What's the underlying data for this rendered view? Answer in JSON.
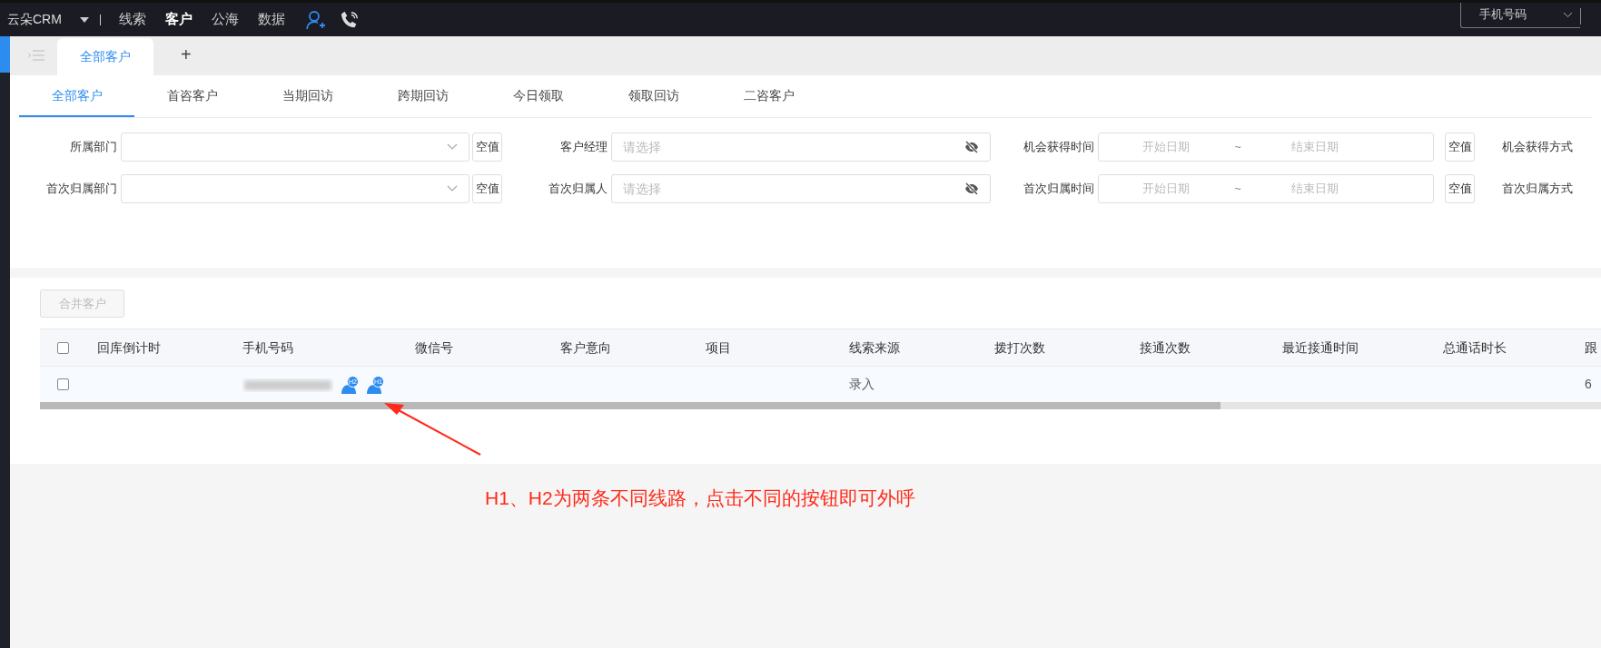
{
  "topbar": {
    "brand": "云朵CRM",
    "nav": [
      {
        "label": "线索",
        "selected": false
      },
      {
        "label": "客户",
        "selected": true
      },
      {
        "label": "公海",
        "selected": false
      },
      {
        "label": "数据",
        "selected": false
      }
    ],
    "search_type": "手机号码"
  },
  "page_tabs": [
    {
      "label": "全部客户",
      "selected": true
    }
  ],
  "add_tab": "+",
  "sub_tabs": [
    {
      "label": "全部客户",
      "selected": true
    },
    {
      "label": "首咨客户",
      "selected": false
    },
    {
      "label": "当期回访",
      "selected": false
    },
    {
      "label": "跨期回访",
      "selected": false
    },
    {
      "label": "今日领取",
      "selected": false
    },
    {
      "label": "领取回访",
      "selected": false
    },
    {
      "label": "二咨客户",
      "selected": false
    }
  ],
  "filters": [
    [
      {
        "kind": "select",
        "label": "所属部门",
        "empty_button": "空值"
      },
      {
        "kind": "picker",
        "label": "客户经理",
        "placeholder": "请选择"
      },
      {
        "kind": "daterange",
        "label": "机会获得时间",
        "start": "开始日期",
        "sep": "~",
        "end": "结束日期",
        "empty_button": "空值"
      },
      {
        "kind": "label",
        "label": "机会获得方式"
      }
    ],
    [
      {
        "kind": "select",
        "label": "首次归属部门",
        "empty_button": "空值"
      },
      {
        "kind": "picker",
        "label": "首次归属人",
        "placeholder": "请选择"
      },
      {
        "kind": "daterange",
        "label": "首次归属时间",
        "start": "开始日期",
        "sep": "~",
        "end": "结束日期",
        "empty_button": "空值"
      },
      {
        "kind": "label",
        "label": "首次归属方式"
      }
    ]
  ],
  "merge_button": {
    "label": "合并客户",
    "disabled": true
  },
  "table": {
    "columns": [
      "回库倒计时",
      "手机号码",
      "微信号",
      "客户意向",
      "项目",
      "线索来源",
      "拨打次数",
      "接通次数",
      "最近接通时间",
      "总通话时长",
      "跟"
    ],
    "rows": [
      {
        "checked": false,
        "cells": [
          "",
          "",
          "",
          "",
          "",
          "录入",
          "",
          "",
          "",
          "",
          "6"
        ],
        "line_buttons": [
          "H2",
          "H1"
        ]
      }
    ],
    "header_checked": false
  },
  "annotation": "H1、H2为两条不同线路，点击不同的按钮即可外呼"
}
